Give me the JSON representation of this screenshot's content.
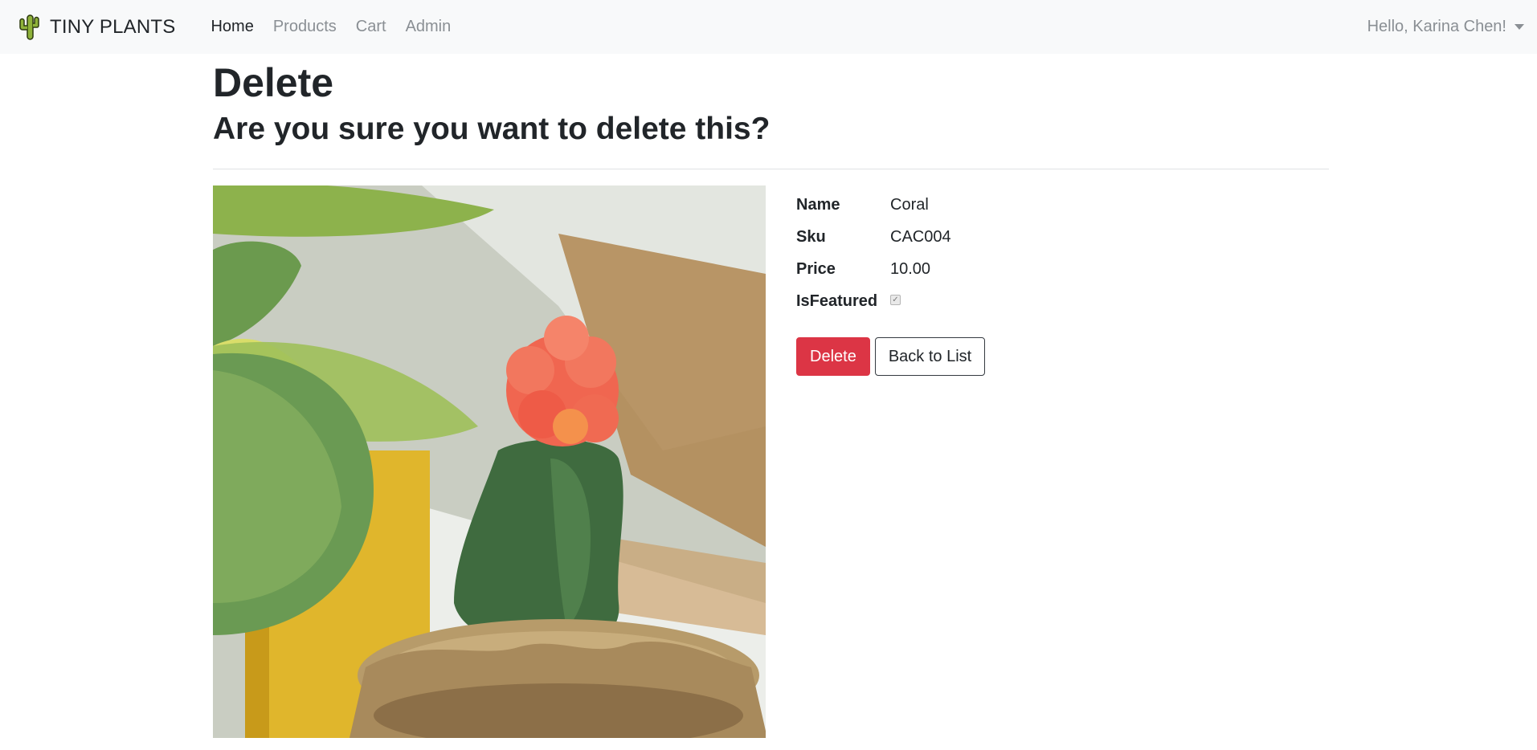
{
  "app": {
    "brand": "TINY PLANTS"
  },
  "nav": {
    "items": [
      {
        "label": "Home",
        "active": true
      },
      {
        "label": "Products",
        "active": false
      },
      {
        "label": "Cart",
        "active": false
      },
      {
        "label": "Admin",
        "active": false
      }
    ],
    "user_greeting": "Hello, Karina Chen!"
  },
  "page": {
    "title": "Delete",
    "subtitle": "Are you sure you want to delete this?"
  },
  "product": {
    "image_icon": "cactus-photo",
    "fields": [
      {
        "label": "Name",
        "value": "Coral"
      },
      {
        "label": "Sku",
        "value": "CAC004"
      },
      {
        "label": "Price",
        "value": "10.00"
      },
      {
        "label": "IsFeatured",
        "checked": true
      }
    ]
  },
  "actions": {
    "delete_label": "Delete",
    "back_label": "Back to List"
  },
  "colors": {
    "navbar_bg": "#f8f9fa",
    "danger": "#dc3545",
    "text": "#212529",
    "muted": "#8a8f94"
  }
}
